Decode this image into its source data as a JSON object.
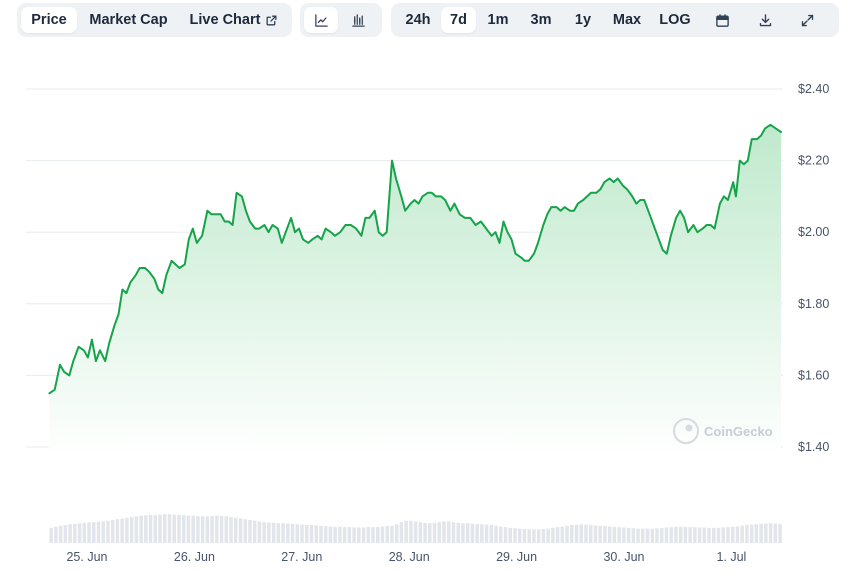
{
  "toolbar": {
    "type_tabs": [
      {
        "label": "Price",
        "active": true
      },
      {
        "label": "Market Cap",
        "active": false
      },
      {
        "label": "Live Chart",
        "active": false,
        "icon": "external-link-icon"
      }
    ],
    "view_buttons": [
      {
        "icon": "line-chart-icon",
        "active": true
      },
      {
        "icon": "candlestick-chart-icon",
        "active": false
      }
    ],
    "range_tabs": [
      {
        "label": "24h",
        "active": false
      },
      {
        "label": "7d",
        "active": true
      },
      {
        "label": "1m",
        "active": false
      },
      {
        "label": "3m",
        "active": false
      },
      {
        "label": "1y",
        "active": false
      },
      {
        "label": "Max",
        "active": false
      },
      {
        "label": "LOG",
        "active": false
      }
    ],
    "action_buttons": [
      {
        "icon": "calendar-icon"
      },
      {
        "icon": "download-icon"
      },
      {
        "icon": "fullscreen-icon"
      }
    ]
  },
  "watermark": "CoinGecko",
  "colors": {
    "line": "#16a34a",
    "area_top": "#bfe9cc",
    "area_bottom": "#ffffff",
    "volume": "#e2e6ea",
    "grid": "#e8ebef"
  },
  "chart_data": {
    "type": "area",
    "ylim": [
      1.35,
      2.5
    ],
    "y_ticks": [
      {
        "value": 1.4,
        "label": "$1.40"
      },
      {
        "value": 1.6,
        "label": "$1.60"
      },
      {
        "value": 1.8,
        "label": "$1.80"
      },
      {
        "value": 2.0,
        "label": "$2.00"
      },
      {
        "value": 2.2,
        "label": "$2.20"
      },
      {
        "value": 2.4,
        "label": "$2.40"
      }
    ],
    "x_ticks": [
      "25. Jun",
      "26. Jun",
      "27. Jun",
      "28. Jun",
      "29. Jun",
      "30. Jun",
      "1. Jul"
    ],
    "x_start_offset": -0.35,
    "x_end_offset": 6.72,
    "grid": true,
    "price": [
      [
        -0.35,
        1.55
      ],
      [
        -0.31,
        1.56
      ],
      [
        -0.27,
        1.63
      ],
      [
        -0.24,
        1.61
      ],
      [
        -0.2,
        1.6
      ],
      [
        -0.17,
        1.64
      ],
      [
        -0.13,
        1.68
      ],
      [
        -0.09,
        1.67
      ],
      [
        -0.06,
        1.65
      ],
      [
        -0.03,
        1.7
      ],
      [
        0.0,
        1.64
      ],
      [
        0.03,
        1.67
      ],
      [
        0.07,
        1.64
      ],
      [
        0.1,
        1.69
      ],
      [
        0.14,
        1.74
      ],
      [
        0.17,
        1.77
      ],
      [
        0.2,
        1.84
      ],
      [
        0.23,
        1.83
      ],
      [
        0.26,
        1.86
      ],
      [
        0.3,
        1.88
      ],
      [
        0.33,
        1.9
      ],
      [
        0.37,
        1.9
      ],
      [
        0.4,
        1.89
      ],
      [
        0.44,
        1.87
      ],
      [
        0.47,
        1.84
      ],
      [
        0.5,
        1.83
      ],
      [
        0.53,
        1.88
      ],
      [
        0.57,
        1.92
      ],
      [
        0.6,
        1.91
      ],
      [
        0.63,
        1.9
      ],
      [
        0.67,
        1.91
      ],
      [
        0.7,
        1.98
      ],
      [
        0.73,
        2.01
      ],
      [
        0.76,
        1.97
      ],
      [
        0.8,
        1.99
      ],
      [
        0.84,
        2.06
      ],
      [
        0.87,
        2.05
      ],
      [
        0.91,
        2.05
      ],
      [
        0.94,
        2.05
      ],
      [
        0.97,
        2.03
      ],
      [
        1.0,
        2.03
      ],
      [
        1.03,
        2.02
      ],
      [
        1.06,
        2.11
      ],
      [
        1.1,
        2.1
      ],
      [
        1.13,
        2.06
      ],
      [
        1.16,
        2.03
      ],
      [
        1.2,
        2.01
      ],
      [
        1.23,
        2.01
      ],
      [
        1.27,
        2.02
      ],
      [
        1.3,
        2.0
      ],
      [
        1.33,
        2.02
      ],
      [
        1.37,
        2.01
      ],
      [
        1.4,
        1.97
      ],
      [
        1.43,
        2.0
      ],
      [
        1.47,
        2.04
      ],
      [
        1.5,
        2.0
      ],
      [
        1.53,
        2.01
      ],
      [
        1.56,
        1.98
      ],
      [
        1.6,
        1.97
      ],
      [
        1.63,
        1.98
      ],
      [
        1.67,
        1.99
      ],
      [
        1.7,
        1.98
      ],
      [
        1.73,
        2.01
      ],
      [
        1.77,
        2.0
      ],
      [
        1.8,
        1.99
      ],
      [
        1.84,
        2.0
      ],
      [
        1.88,
        2.02
      ],
      [
        1.92,
        2.02
      ],
      [
        1.96,
        2.01
      ],
      [
        2.0,
        1.99
      ],
      [
        2.03,
        2.04
      ],
      [
        2.06,
        2.04
      ],
      [
        2.1,
        2.06
      ],
      [
        2.13,
        2.0
      ],
      [
        2.16,
        1.99
      ],
      [
        2.19,
        2.0
      ],
      [
        2.23,
        2.2
      ],
      [
        2.26,
        2.15
      ],
      [
        2.3,
        2.1
      ],
      [
        2.33,
        2.06
      ],
      [
        2.37,
        2.08
      ],
      [
        2.4,
        2.09
      ],
      [
        2.43,
        2.08
      ],
      [
        2.46,
        2.1
      ],
      [
        2.5,
        2.11
      ],
      [
        2.53,
        2.11
      ],
      [
        2.56,
        2.1
      ],
      [
        2.6,
        2.1
      ],
      [
        2.63,
        2.09
      ],
      [
        2.67,
        2.06
      ],
      [
        2.7,
        2.08
      ],
      [
        2.74,
        2.05
      ],
      [
        2.78,
        2.04
      ],
      [
        2.82,
        2.04
      ],
      [
        2.86,
        2.02
      ],
      [
        2.9,
        2.03
      ],
      [
        2.94,
        2.01
      ],
      [
        2.98,
        1.99
      ],
      [
        3.01,
        2.0
      ],
      [
        3.04,
        1.97
      ],
      [
        3.07,
        2.03
      ],
      [
        3.1,
        2.0
      ],
      [
        3.13,
        1.98
      ],
      [
        3.16,
        1.94
      ],
      [
        3.2,
        1.93
      ],
      [
        3.23,
        1.92
      ],
      [
        3.26,
        1.92
      ],
      [
        3.3,
        1.94
      ],
      [
        3.33,
        1.97
      ],
      [
        3.37,
        2.02
      ],
      [
        3.4,
        2.05
      ],
      [
        3.43,
        2.07
      ],
      [
        3.47,
        2.07
      ],
      [
        3.5,
        2.06
      ],
      [
        3.53,
        2.07
      ],
      [
        3.57,
        2.06
      ],
      [
        3.6,
        2.06
      ],
      [
        3.63,
        2.08
      ],
      [
        3.67,
        2.09
      ],
      [
        3.7,
        2.1
      ],
      [
        3.73,
        2.11
      ],
      [
        3.77,
        2.11
      ],
      [
        3.8,
        2.12
      ],
      [
        3.83,
        2.14
      ],
      [
        3.87,
        2.15
      ],
      [
        3.9,
        2.14
      ],
      [
        3.93,
        2.15
      ],
      [
        3.97,
        2.13
      ],
      [
        4.0,
        2.12
      ],
      [
        4.04,
        2.1
      ],
      [
        4.07,
        2.08
      ],
      [
        4.1,
        2.09
      ],
      [
        4.13,
        2.09
      ],
      [
        4.17,
        2.05
      ],
      [
        4.2,
        2.02
      ],
      [
        4.23,
        1.99
      ],
      [
        4.27,
        1.95
      ],
      [
        4.3,
        1.94
      ],
      [
        4.33,
        1.99
      ],
      [
        4.37,
        2.04
      ],
      [
        4.4,
        2.06
      ],
      [
        4.43,
        2.04
      ],
      [
        4.46,
        2.0
      ],
      [
        4.5,
        2.02
      ],
      [
        4.53,
        2.0
      ],
      [
        4.57,
        2.01
      ],
      [
        4.6,
        2.02
      ],
      [
        4.63,
        2.02
      ],
      [
        4.66,
        2.01
      ],
      [
        4.7,
        2.08
      ],
      [
        4.73,
        2.1
      ],
      [
        4.76,
        2.09
      ],
      [
        4.8,
        2.14
      ],
      [
        4.82,
        2.1
      ],
      [
        4.85,
        2.2
      ],
      [
        4.88,
        2.19
      ],
      [
        4.91,
        2.2
      ],
      [
        4.94,
        2.26
      ],
      [
        4.98,
        2.26
      ],
      [
        5.01,
        2.27
      ],
      [
        5.04,
        2.29
      ],
      [
        5.08,
        2.3
      ],
      [
        5.12,
        2.29
      ],
      [
        5.16,
        2.28
      ]
    ],
    "volume": [
      0.42,
      0.45,
      0.48,
      0.5,
      0.52,
      0.53,
      0.55,
      0.56,
      0.57,
      0.58,
      0.59,
      0.6,
      0.62,
      0.64,
      0.66,
      0.68,
      0.7,
      0.72,
      0.74,
      0.76,
      0.77,
      0.78,
      0.78,
      0.79,
      0.8,
      0.8,
      0.79,
      0.78,
      0.77,
      0.76,
      0.76,
      0.75,
      0.74,
      0.74,
      0.75,
      0.76,
      0.75,
      0.74,
      0.72,
      0.7,
      0.68,
      0.66,
      0.64,
      0.62,
      0.6,
      0.58,
      0.57,
      0.56,
      0.55,
      0.55,
      0.54,
      0.53,
      0.52,
      0.51,
      0.5,
      0.5,
      0.49,
      0.48,
      0.47,
      0.46,
      0.45,
      0.45,
      0.44,
      0.44,
      0.43,
      0.43,
      0.43,
      0.44,
      0.44,
      0.45,
      0.46,
      0.47,
      0.48,
      0.52,
      0.58,
      0.62,
      0.62,
      0.6,
      0.58,
      0.56,
      0.55,
      0.56,
      0.58,
      0.6,
      0.6,
      0.58,
      0.56,
      0.55,
      0.55,
      0.54,
      0.53,
      0.52,
      0.51,
      0.5,
      0.48,
      0.46,
      0.44,
      0.42,
      0.41,
      0.4,
      0.39,
      0.38,
      0.38,
      0.38,
      0.39,
      0.4,
      0.42,
      0.44,
      0.46,
      0.48,
      0.5,
      0.51,
      0.52,
      0.51,
      0.5,
      0.49,
      0.48,
      0.47,
      0.46,
      0.45,
      0.44,
      0.43,
      0.42,
      0.41,
      0.4,
      0.4,
      0.4,
      0.4,
      0.41,
      0.42,
      0.43,
      0.44,
      0.45,
      0.45,
      0.45,
      0.44,
      0.44,
      0.43,
      0.43,
      0.42,
      0.42,
      0.42,
      0.43,
      0.44,
      0.45,
      0.46,
      0.48,
      0.5,
      0.51,
      0.52,
      0.53,
      0.54,
      0.55,
      0.54,
      0.53
    ]
  }
}
